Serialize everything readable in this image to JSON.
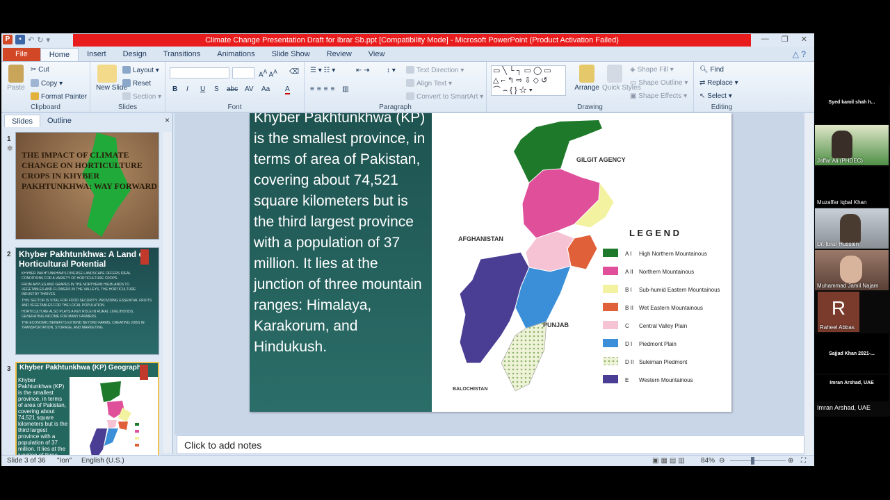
{
  "window": {
    "title": "Climate Change Presentation Draft for Ibrar Sb.ppt [Compatibility Mode]  -  Microsoft PowerPoint (Product Activation Failed)",
    "controls": [
      "—",
      "❐",
      "✕"
    ]
  },
  "tabs": [
    "File",
    "Home",
    "Insert",
    "Design",
    "Transitions",
    "Animations",
    "Slide Show",
    "Review",
    "View"
  ],
  "ribbon": {
    "clipboard": {
      "paste": "Paste",
      "cut": "Cut",
      "copy": "Copy",
      "format_painter": "Format Painter",
      "label": "Clipboard"
    },
    "slides": {
      "new_slide": "New Slide",
      "layout": "Layout",
      "reset": "Reset",
      "section": "Section",
      "label": "Slides"
    },
    "font": {
      "label": "Font",
      "bold": "B",
      "italic": "I",
      "underline": "U",
      "strike": "S",
      "shadow": "abc",
      "spacing": "AV",
      "case": "Aa",
      "color": "A"
    },
    "paragraph": {
      "text_direction": "Text Direction",
      "align_text": "Align Text",
      "convert": "Convert to SmartArt",
      "label": "Paragraph"
    },
    "drawing": {
      "arrange": "Arrange",
      "quick_styles": "Quick Styles",
      "shape_fill": "Shape Fill",
      "shape_outline": "Shape Outline",
      "shape_effects": "Shape Effects",
      "label": "Drawing"
    },
    "editing": {
      "find": "Find",
      "replace": "Replace",
      "select": "Select",
      "label": "Editing"
    }
  },
  "left_pane": {
    "tabs": [
      "Slides",
      "Outline"
    ],
    "close": "×",
    "slides": [
      {
        "num": "1",
        "title": "THE IMPACT OF CLIMATE CHANGE ON HORTICULTURE CROPS IN KHYBER PAKHTUNKHWA: WAY FORWARD"
      },
      {
        "num": "2",
        "title": "Khyber Pakhtunkhwa: A Land of Horticultural Potential",
        "bullets": [
          "KHYBER PAKHTUNKHWA'S DIVERSE LANDSCAPE OFFERS IDEAL CONDITIONS FOR A VARIETY OF HORTICULTURE CROPS.",
          "FROM APPLES AND GRAPES IN THE NORTHERN HIGHLANDS TO VEGETABLES AND FLOWERS IN THE VALLEYS, THE HORTICULTURE INDUSTRY THRIVES.",
          "THIS SECTOR IS VITAL FOR FOOD SECURITY, PROVIDING ESSENTIAL FRUITS AND VEGETABLES FOR THE LOCAL POPULATION.",
          "HORTICULTURE ALSO PLAYS A KEY ROLE IN RURAL LIVELIHOODS, GENERATING INCOME FOR MANY FARMERS.",
          "THE ECONOMIC BENEFITS EXTEND BEYOND FARMS, CREATING JOBS IN TRANSPORTATION, STORAGE, AND MARKETING."
        ]
      },
      {
        "num": "3",
        "title": "Khyber Pakhtunkhwa (KP) Geography",
        "body": "Khyber Pakhtunkhwa (KP) is the smallest province, in terms of area of Pakistan, covering about 74,521 square kilometers but is the third largest province with a population of 37 million. It lies at the junction of three"
      }
    ]
  },
  "slide": {
    "text": "Khyber Pakhtunkhwa (KP) is the smallest province, in terms of area of Pakistan, covering about 74,521 square kilometers but is the third largest province with a population of 37 million. It lies at the junction of three mountain ranges: Himalaya, Karakorum, and Hindukush.",
    "map": {
      "labels": {
        "gilgit": "GILGIT AGENCY",
        "afghanistan": "AFGHANISTAN",
        "punjab": "PUNJAB",
        "balochistan": "BALOCHISTAN"
      },
      "legend_title": "L E G E N D",
      "legend": [
        {
          "code": "A I",
          "name": "High Northern Mountainous",
          "color": "#1e7a2a"
        },
        {
          "code": "A II",
          "name": "Northern Mountainous",
          "color": "#e0509a"
        },
        {
          "code": "B I",
          "name": "Sub-humid Eastern Mountainous",
          "color": "#f2f2a0"
        },
        {
          "code": "B II",
          "name": "Wet Eastern Mountainous",
          "color": "#e0603a"
        },
        {
          "code": "C",
          "name": "Central Valley Plain",
          "color": "#f6c3d4"
        },
        {
          "code": "D I",
          "name": "Piedmont Plain",
          "color": "#3a8fd8"
        },
        {
          "code": "D II",
          "name": "Suleiman Piedmont",
          "color": "#e8f0c8"
        },
        {
          "code": "E",
          "name": "Western Mountainous",
          "color": "#4a3d94"
        }
      ]
    }
  },
  "notes_placeholder": "Click to add notes",
  "status": {
    "slide": "Slide 3 of 36",
    "theme": "\"Ion\"",
    "lang": "English (U.S.)",
    "zoom": "84%"
  },
  "participants": [
    {
      "name": "Syed kamil shah h...",
      "style": "top"
    },
    {
      "name": "Jaffar Ali (PHDEC)",
      "style": "video"
    },
    {
      "name": "Muzaffar Iqbal Khan",
      "style": "name"
    },
    {
      "name": "Dr. Ibrar Hussain",
      "style": "video"
    },
    {
      "name": "Muhammad Jamil Najam",
      "style": "video"
    },
    {
      "name": "Raheel Abbas",
      "style": "avatar",
      "initial": "R"
    },
    {
      "name": "Sajjad Khan 2021-...",
      "style": "top"
    },
    {
      "name": "Imran Arshad, UAE",
      "style": "top"
    },
    {
      "name": "Imran Arshad, UAE",
      "style": "name"
    }
  ]
}
